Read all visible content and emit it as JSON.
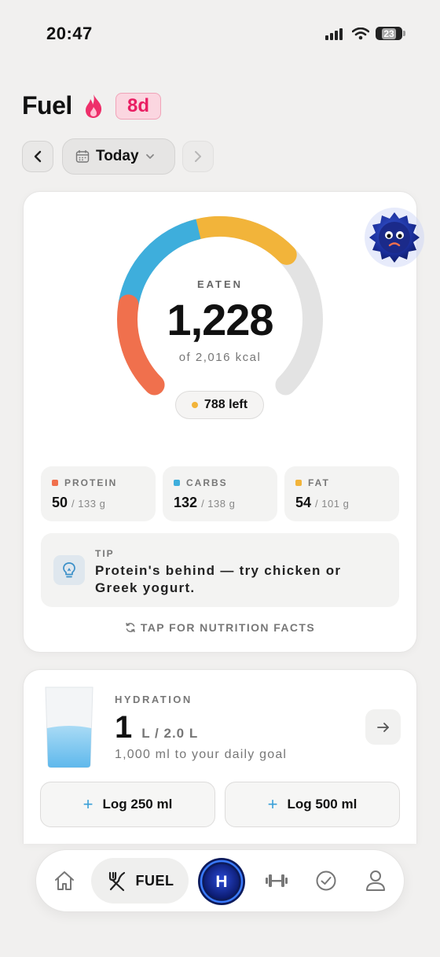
{
  "status": {
    "time": "20:47",
    "battery": "23"
  },
  "header": {
    "title": "Fuel",
    "streak": "8d"
  },
  "date_nav": {
    "label": "Today"
  },
  "calories": {
    "label": "EATEN",
    "eaten": "1,228",
    "of_text": "of 2,016 kcal",
    "left_text": "788 left",
    "progress": {
      "protein_fraction": 0.2,
      "carbs_fraction": 0.25,
      "fat_fraction": 0.22
    }
  },
  "macros": [
    {
      "name": "PROTEIN",
      "value": "50",
      "target": "/ 133 g",
      "color": "#f0704d"
    },
    {
      "name": "CARBS",
      "value": "132",
      "target": "/ 138 g",
      "color": "#3eaedc"
    },
    {
      "name": "FAT",
      "value": "54",
      "target": "/ 101 g",
      "color": "#f2b43a"
    }
  ],
  "tip": {
    "label": "TIP",
    "text": "Protein's behind — try chicken or Greek yogurt."
  },
  "nutrition_facts": "TAP FOR NUTRITION FACTS",
  "hydration": {
    "label": "HYDRATION",
    "amount": "1",
    "unit": "L / 2.0 L",
    "subtitle": "1,000 ml to your daily goal",
    "log_small": "Log 250 ml",
    "log_large": "Log 500 ml"
  },
  "tabbar": {
    "active_label": "FUEL",
    "center_label": "H",
    "icons": [
      "home-icon",
      "fork-knife-icon",
      "dumbbell-icon",
      "check-circle-icon",
      "profile-icon"
    ]
  },
  "colors": {
    "accent": "#e91e63",
    "protein": "#f0704d",
    "carbs": "#3eaedc",
    "fat": "#f2b43a"
  }
}
